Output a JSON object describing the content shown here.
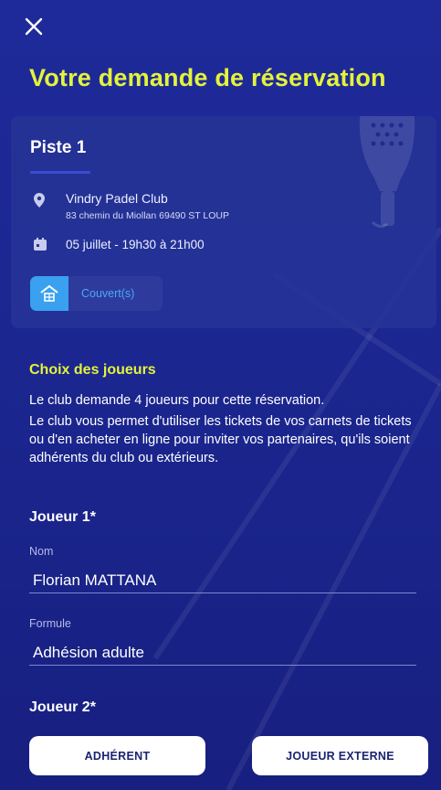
{
  "header": {
    "close_icon": "close-icon",
    "title": "Votre demande de réservation"
  },
  "court": {
    "name": "Piste 1",
    "club_name": "Vindry Padel Club",
    "club_address": "83 chemin du Miollan 69490 ST LOUP",
    "slot": "05 juillet - 19h30 à 21h00",
    "badge_label": "Couvert(s)",
    "icons": {
      "location": "location-pin-icon",
      "calendar": "calendar-icon",
      "covered": "covered-court-icon",
      "racket": "padel-racket-icon"
    }
  },
  "players_section": {
    "title": "Choix des joueurs",
    "paragraph_1": "Le club demande 4 joueurs pour cette réservation.",
    "paragraph_2": "Le club vous permet d'utiliser les tickets de vos carnets de tickets ou d'en acheter en ligne pour inviter vos partenaires, qu'ils soient adhérents du club ou extérieurs."
  },
  "player1": {
    "heading": "Joueur 1*",
    "name_label": "Nom",
    "name_value": "Florian MATTANA",
    "formula_label": "Formule",
    "formula_value": "Adhésion adulte"
  },
  "player2": {
    "heading": "Joueur 2*"
  },
  "actions": {
    "member_label": "ADHÉRENT",
    "external_label": "JOUEUR EXTERNE"
  },
  "colors": {
    "accent_yellow": "#e4f33a",
    "background": "#1f2a9a",
    "badge_blue": "#3aa0f0"
  }
}
